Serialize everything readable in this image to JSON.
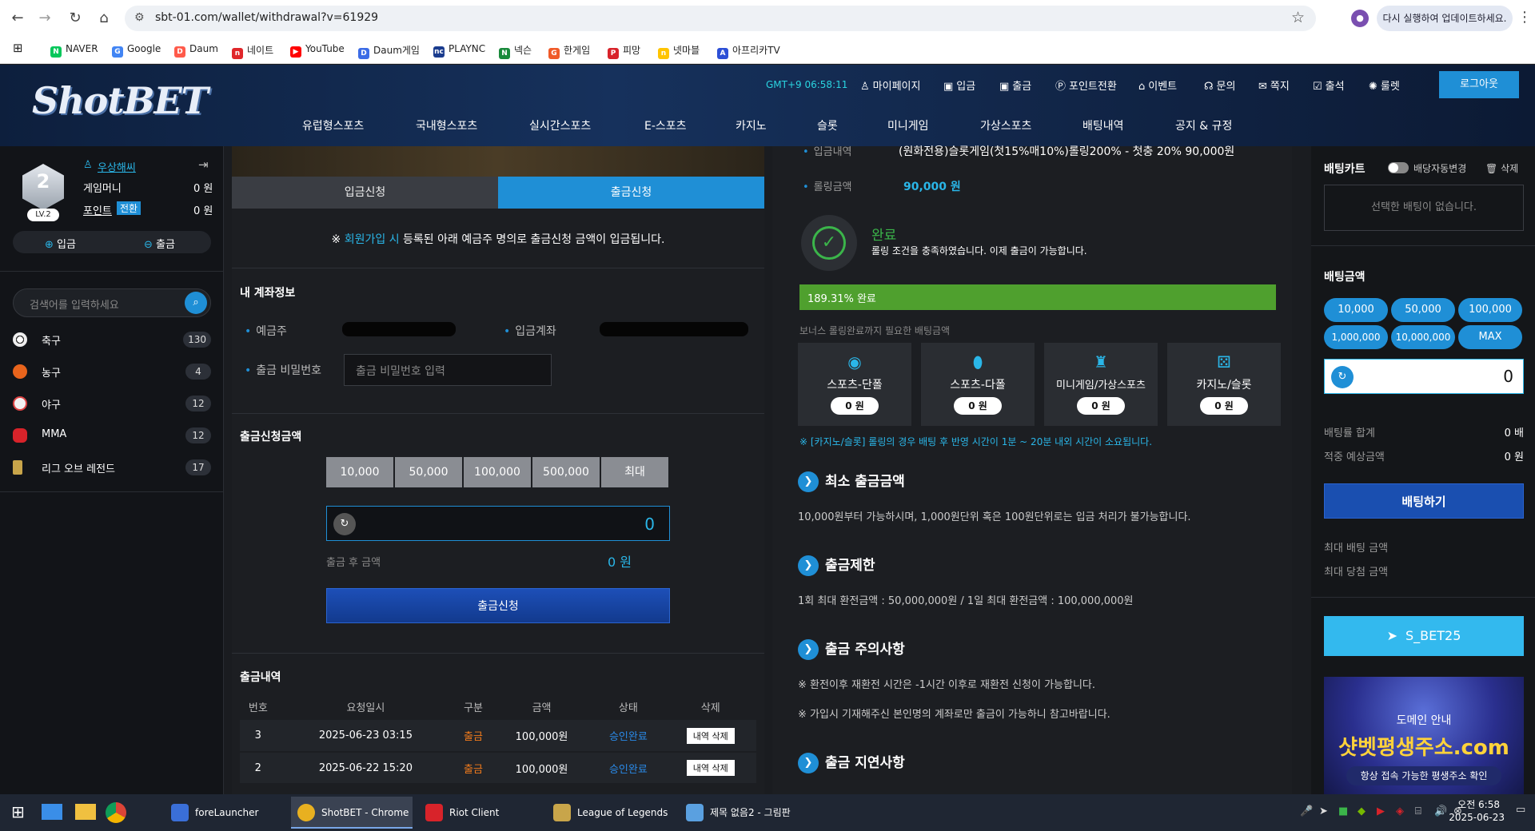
{
  "browser": {
    "url": "sbt-01.com/wallet/withdrawal?v=61929",
    "update_label": "다시 실행하여 업데이트하세요.",
    "bookmarks": [
      {
        "label": "NAVER",
        "color": "#03c75a",
        "glyph": "N"
      },
      {
        "label": "Google",
        "color": "#4285f4",
        "glyph": "G"
      },
      {
        "label": "Daum",
        "color": "#ff5a4a",
        "glyph": "D"
      },
      {
        "label": "네이트",
        "color": "#e0262a",
        "glyph": "n"
      },
      {
        "label": "YouTube",
        "color": "#ff0000",
        "glyph": "▶"
      },
      {
        "label": "Daum게임",
        "color": "#3c6ce6",
        "glyph": "D"
      },
      {
        "label": "PLAYNC",
        "color": "#1a3c8e",
        "glyph": "nc"
      },
      {
        "label": "넥슨",
        "color": "#1a8a3c",
        "glyph": "N"
      },
      {
        "label": "한게임",
        "color": "#f05a28",
        "glyph": "G"
      },
      {
        "label": "피망",
        "color": "#d8232a",
        "glyph": "P"
      },
      {
        "label": "넷마블",
        "color": "#ffc400",
        "glyph": "n"
      },
      {
        "label": "아프리카TV",
        "color": "#2c4fd6",
        "glyph": "A"
      }
    ]
  },
  "header": {
    "logo": "ShotBET",
    "clock": "GMT+9 06:58:11",
    "top_nav": [
      {
        "label": "마이페이지",
        "icon": "user-icon",
        "glyph": "♙"
      },
      {
        "label": "입금",
        "icon": "deposit-icon",
        "glyph": "▣"
      },
      {
        "label": "출금",
        "icon": "withdraw-icon",
        "glyph": "▣"
      },
      {
        "label": "포인트전환",
        "icon": "point-icon",
        "glyph": "Ⓟ"
      },
      {
        "label": "이벤트",
        "icon": "gift-icon",
        "glyph": "⌂"
      },
      {
        "label": "문의",
        "icon": "headset-icon",
        "glyph": "☊"
      },
      {
        "label": "쪽지",
        "icon": "mail-icon",
        "glyph": "✉"
      },
      {
        "label": "출석",
        "icon": "calendar-icon",
        "glyph": "☑"
      },
      {
        "label": "룰렛",
        "icon": "roulette-icon",
        "glyph": "✺"
      }
    ],
    "logout_label": "로그아웃",
    "main_nav": [
      "유럽형스포츠",
      "국내형스포츠",
      "실시간스포츠",
      "E-스포츠",
      "카지노",
      "슬롯",
      "미니게임",
      "가상스포츠",
      "배팅내역",
      "공지 & 규정"
    ]
  },
  "user": {
    "level_num": "2",
    "level_label": "LV.2",
    "name": "우상해씨",
    "game_money_label": "게임머니",
    "game_money_value": "0 원",
    "point_label": "포인트",
    "point_switch": "전환",
    "point_value": "0 원",
    "deposit_label": "입금",
    "withdraw_label": "출금"
  },
  "search": {
    "placeholder": "검색어를 입력하세요"
  },
  "sports": [
    {
      "name": "축구",
      "count": "130",
      "color": "#ddd"
    },
    {
      "name": "농구",
      "count": "4",
      "color": "#e8641c"
    },
    {
      "name": "야구",
      "count": "12",
      "color": "#f2f2f2"
    },
    {
      "name": "MMA",
      "count": "12",
      "color": "#d8232a"
    },
    {
      "name": "리그 오브 레전드",
      "count": "17",
      "color": "#c8a54a"
    }
  ],
  "withdraw": {
    "tab_deposit": "입금신청",
    "tab_withdraw": "출금신청",
    "notice_prefix": "※ ",
    "notice_link": "회원가입 시",
    "notice_rest": " 등록된 아래 예금주 명의로 출금신청 금액이 입금됩니다.",
    "account_title": "내 계좌정보",
    "holder_label": "예금주",
    "account_label": "입금계좌",
    "password_label": "출금 비밀번호",
    "password_placeholder": "출금 비밀번호 입력",
    "amount_title": "출금신청금액",
    "quick_amounts": [
      "10,000",
      "50,000",
      "100,000",
      "500,000",
      "최대"
    ],
    "amount_value": "0",
    "after_label": "출금 후 금액",
    "after_value": "0 원",
    "submit_label": "출금신청",
    "history_title": "출금내역",
    "history_headers": [
      "번호",
      "요청일시",
      "구분",
      "금액",
      "상태",
      "삭제"
    ],
    "history_rows": [
      {
        "no": "3",
        "date": "2025-06-23 03:15",
        "type": "출금",
        "amount": "100,000원",
        "status": "승인완료",
        "action": "내역 삭제"
      },
      {
        "no": "2",
        "date": "2025-06-22 15:20",
        "type": "출금",
        "amount": "100,000원",
        "status": "승인완료",
        "action": "내역 삭제"
      }
    ]
  },
  "rolling": {
    "history_label": "입금내역",
    "history_value": "(원화전용)슬롯게임(첫15%매10%)롤링200% - 첫충 20% 90,000원",
    "amount_label": "롤링금액",
    "amount_value": "90,000 원",
    "status_title": "완료",
    "status_desc": "롤링 조건을 충족하였습니다. 이제 출금이 가능합니다.",
    "progress_pct": 100,
    "progress_label": "189.31% 완료",
    "required_label": "보너스 롤링완료까지 필요한 배팅금액",
    "categories": [
      {
        "name": "스포츠-단폴",
        "value": "0 원",
        "icon": "basketball-icon",
        "glyph": "⚽"
      },
      {
        "name": "스포츠-다폴",
        "value": "0 원",
        "icon": "football-icon",
        "glyph": "🏈"
      },
      {
        "name": "미니게임/가상스포츠",
        "value": "0 원",
        "icon": "minigame-icon",
        "glyph": "♜"
      },
      {
        "name": "카지노/슬롯",
        "value": "0 원",
        "icon": "dice-icon",
        "glyph": "⚄"
      }
    ],
    "casino_note": "※ [카지노/슬롯] 롤링의 경우 배팅 후 반영 시간이 1분 ~ 20분 내외 시간이 소요됩니다."
  },
  "info": {
    "min_title": "최소 출금금액",
    "min_body": "10,000원부터 가능하시며, 1,000원단위 혹은 100원단위로는 입금 처리가 불가능합니다.",
    "limit_title": "출금제한",
    "limit_body": "1회 최대 환전금액 : 50,000,000원 / 1일 최대 환전금액 : 100,000,000원",
    "caution_title": "출금 주의사항",
    "caution_body1": "※ 환전이후 재환전 시간은 -1시간 이후로 재환전 신청이 가능합니다.",
    "caution_body2": "※ 가입시 기재해주신 본인명의 계좌로만 출금이 가능하니 참고바랍니다.",
    "delay_title": "출금 지연사항"
  },
  "betslip": {
    "title": "배팅카트",
    "auto_label": "배당자동변경",
    "delete_label": "삭제",
    "empty_label": "선택한 배팅이 없습니다.",
    "amount_title": "배팅금액",
    "chips": [
      "10,000",
      "50,000",
      "100,000",
      "1,000,000",
      "10,000,000",
      "MAX"
    ],
    "amount_value": "0",
    "odds_label": "배팅률 합계",
    "odds_value": "0 배",
    "expected_label": "적중 예상금액",
    "expected_value": "0 원",
    "bet_button": "배팅하기",
    "max_bet_label": "최대 배팅 금액",
    "max_win_label": "최대 당첨 금액",
    "telegram_label": "S_BET25",
    "banner_line1": "도메인 안내",
    "banner_line2": "샷벳평생주소.com",
    "banner_line3": "항상 접속 가능한 평생주소 확인"
  },
  "taskbar": {
    "apps": [
      {
        "label": "foreLauncher",
        "color": "#3a6fd8"
      },
      {
        "label": "ShotBET - Chrome",
        "color": "#e8b020"
      },
      {
        "label": "Riot Client",
        "color": "#d8232a"
      },
      {
        "label": "League of Legends",
        "color": "#c8a54a"
      },
      {
        "label": "제목 없음2 - 그림판",
        "color": "#5aa0e0"
      }
    ],
    "time": "오전 6:58",
    "date": "2025-06-23"
  }
}
